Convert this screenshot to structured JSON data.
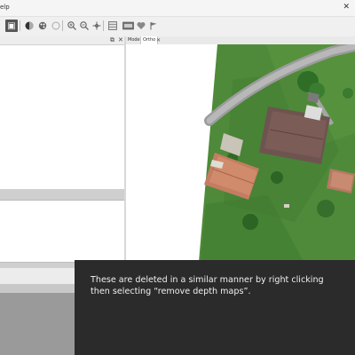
{
  "menu": {
    "help_label": "elp"
  },
  "toolbar": {
    "icons": [
      "select-icon",
      "shaded-sphere-icon",
      "palette-icon",
      "circle-icon",
      "zoom-in-icon",
      "zoom-out-icon",
      "move-icon",
      "grid-icon",
      "camera-icon",
      "heart-icon",
      "flag-icon"
    ]
  },
  "view_tabs": {
    "model": "Model",
    "ortho": "Ortho"
  },
  "caption": {
    "text": "These are deleted in a similar manner by right clicking\nthen selecting “remove depth maps”."
  },
  "colors": {
    "caption_bg": "#2b2b2b",
    "caption_text": "#f0f0f0",
    "grass": "#4e8a3a",
    "roof": "#c98a6a"
  }
}
